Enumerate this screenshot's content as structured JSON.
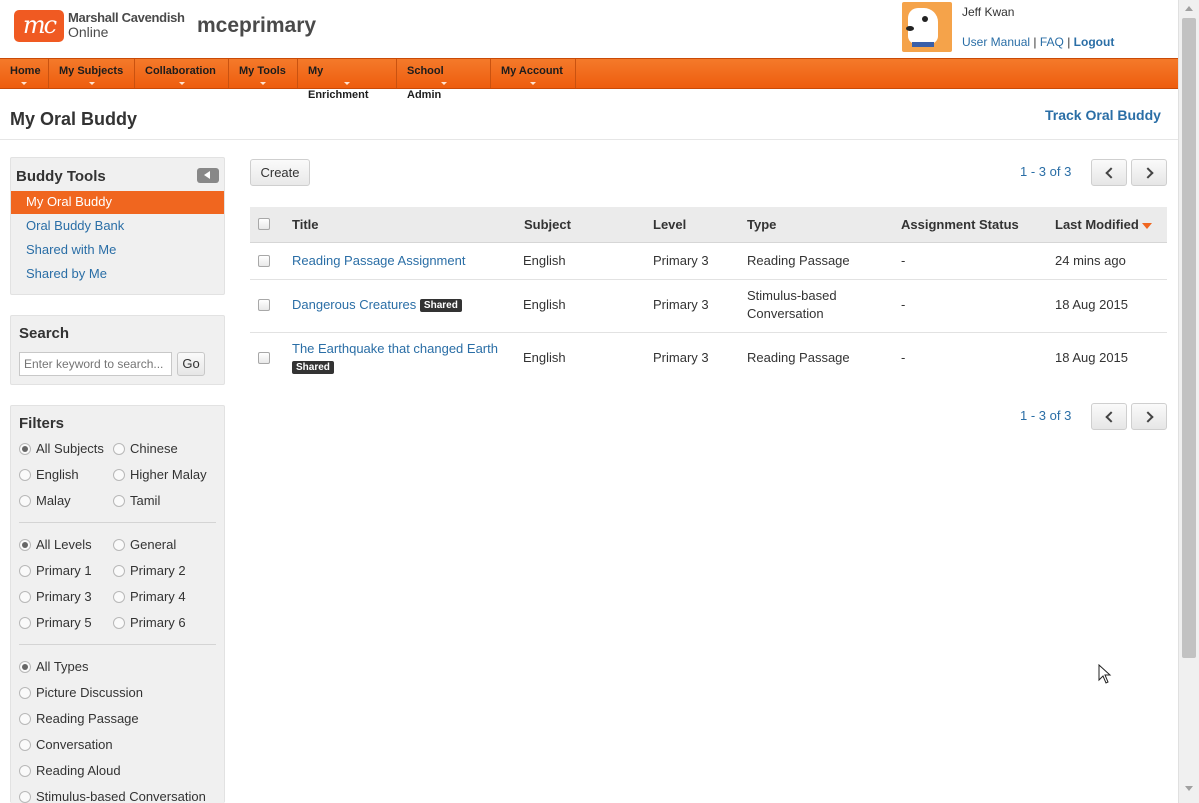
{
  "header": {
    "logo_mark": "mc",
    "logo_line1": "Marshall Cavendish",
    "logo_line2": "Online",
    "site_name": "mceprimary",
    "user_name": "Jeff Kwan",
    "user_manual": "User Manual",
    "faq": "FAQ",
    "logout": "Logout",
    "separator": "|"
  },
  "nav": {
    "items": [
      "Home",
      "My Subjects",
      "Collaboration",
      "My Tools",
      "My Enrichment",
      "School Admin",
      "My Account"
    ]
  },
  "page": {
    "title": "My Oral Buddy",
    "track_link": "Track Oral Buddy"
  },
  "sidebar": {
    "tools_title": "Buddy Tools",
    "tools": [
      "My Oral Buddy",
      "Oral Buddy Bank",
      "Shared with Me",
      "Shared by Me"
    ],
    "search_title": "Search",
    "search_placeholder": "Enter keyword to search...",
    "search_button": "Go",
    "filters_title": "Filters",
    "subjects": [
      "All Subjects",
      "Chinese",
      "English",
      "Higher Malay",
      "Malay",
      "Tamil"
    ],
    "levels": [
      "All Levels",
      "General",
      "Primary 1",
      "Primary 2",
      "Primary 3",
      "Primary 4",
      "Primary 5",
      "Primary 6"
    ],
    "types": [
      "All Types",
      "Picture Discussion",
      "Reading Passage",
      "Conversation",
      "Reading Aloud",
      "Stimulus-based Conversation"
    ]
  },
  "main": {
    "create_label": "Create",
    "pager_text": "1 - 3 of 3",
    "columns": [
      "Title",
      "Subject",
      "Level",
      "Type",
      "Assignment Status",
      "Last Modified"
    ],
    "shared_badge": "Shared",
    "rows": [
      {
        "title": "Reading Passage Assignment",
        "subject": "English",
        "level": "Primary 3",
        "type": "Reading Passage",
        "status": "-",
        "modified": "24 mins ago"
      },
      {
        "title": "Dangerous Creatures",
        "subject": "English",
        "level": "Primary 3",
        "type_line1": "Stimulus-based",
        "type_line2": "Conversation",
        "status": "-",
        "modified": "18 Aug 2015"
      },
      {
        "title": "The Earthquake that changed Earth",
        "subject": "English",
        "level": "Primary 3",
        "type": "Reading Passage",
        "status": "-",
        "modified": "18 Aug 2015"
      }
    ]
  },
  "colors": {
    "brand_orange": "#f0661f",
    "link_blue": "#2a6ea6"
  }
}
